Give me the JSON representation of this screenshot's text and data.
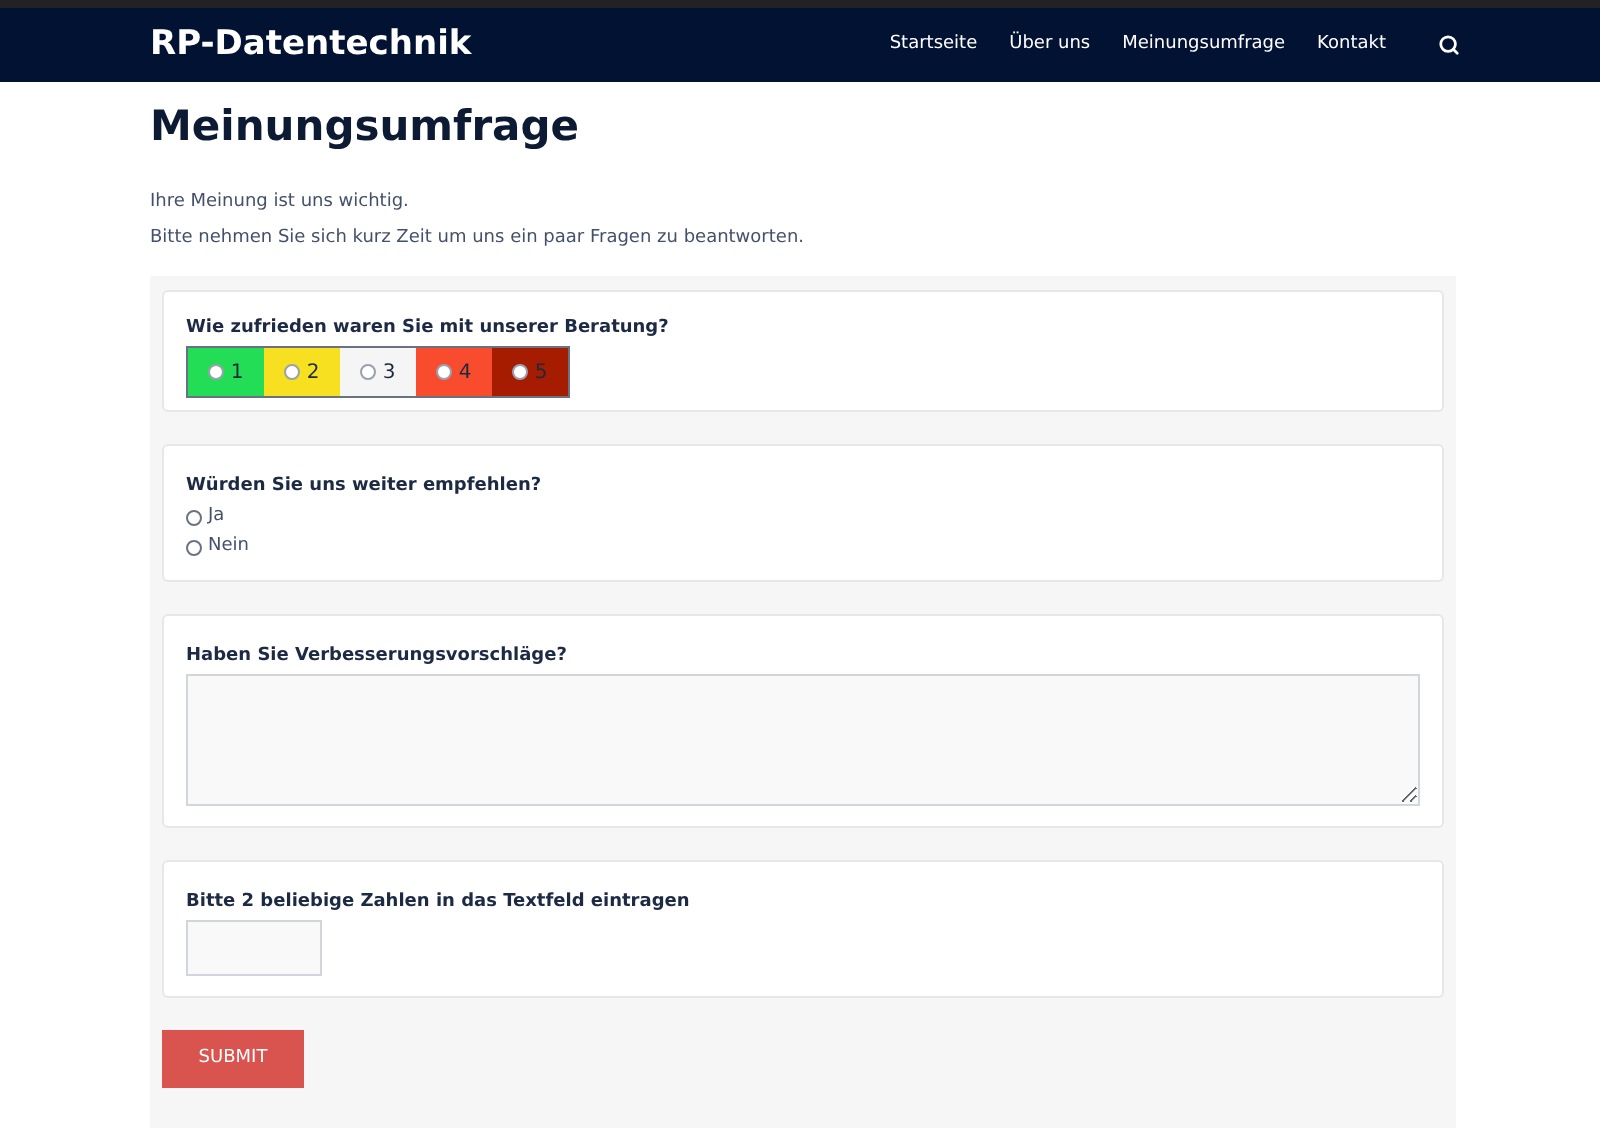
{
  "site": {
    "brand": "RP-Datentechnik",
    "nav": [
      "Startseite",
      "Über uns",
      "Meinungsumfrage",
      "Kontakt"
    ]
  },
  "page": {
    "title": "Meinungsumfrage",
    "intro": [
      "Ihre Meinung ist uns wichtig.",
      "Bitte nehmen Sie sich kurz Zeit um uns ein paar Fragen zu beantworten."
    ]
  },
  "questions": [
    {
      "kind": "rating",
      "label": "Wie zufrieden waren Sie mit unserer Beratung?",
      "options": [
        {
          "label": "1",
          "selected": false,
          "color": "#22dd55"
        },
        {
          "label": "2",
          "selected": false,
          "color": "#f7e01f"
        },
        {
          "label": "3",
          "selected": false,
          "color": "#f5f5f5"
        },
        {
          "label": "4",
          "selected": false,
          "color": "#f94c2e"
        },
        {
          "label": "5",
          "selected": false,
          "color": "#a61c00"
        }
      ]
    },
    {
      "kind": "radio",
      "label": "Würden Sie uns weiter empfehlen?",
      "options": [
        {
          "label": "Ja",
          "selected": false
        },
        {
          "label": "Nein",
          "selected": false
        }
      ]
    },
    {
      "kind": "textarea",
      "label": "Haben Sie Verbesserungsvorschläge?"
    },
    {
      "kind": "text",
      "label": "Bitte 2 beliebige Zahlen in das Textfeld eintragen"
    }
  ],
  "submit": "SUBMIT"
}
